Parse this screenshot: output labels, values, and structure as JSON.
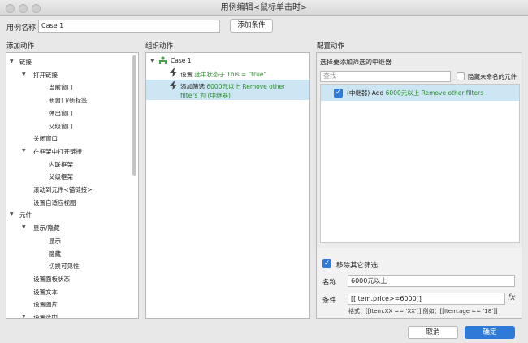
{
  "window": {
    "title": "用例编辑<鼠标单击时>"
  },
  "case_name": {
    "label": "用例名称",
    "value": "Case 1",
    "add_condition": "添加条件"
  },
  "left": {
    "title": "添加动作",
    "items": [
      {
        "label": "链接",
        "level": 0,
        "arrow": true
      },
      {
        "label": "打开链接",
        "level": 1,
        "arrow": true
      },
      {
        "label": "当前窗口",
        "level": 2,
        "arrow": false
      },
      {
        "label": "新窗口/新标签",
        "level": 2,
        "arrow": false
      },
      {
        "label": "弹出窗口",
        "level": 2,
        "arrow": false
      },
      {
        "label": "父级窗口",
        "level": 2,
        "arrow": false
      },
      {
        "label": "关闭窗口",
        "level": 1,
        "arrow": false
      },
      {
        "label": "在框架中打开链接",
        "level": 1,
        "arrow": true
      },
      {
        "label": "内联框架",
        "level": 2,
        "arrow": false
      },
      {
        "label": "父级框架",
        "level": 2,
        "arrow": false
      },
      {
        "label": "滚动到元件<锚链接>",
        "level": 1,
        "arrow": false
      },
      {
        "label": "设置自适应视图",
        "level": 1,
        "arrow": false
      },
      {
        "label": "元件",
        "level": 0,
        "arrow": true
      },
      {
        "label": "显示/隐藏",
        "level": 1,
        "arrow": true
      },
      {
        "label": "显示",
        "level": 2,
        "arrow": false
      },
      {
        "label": "隐藏",
        "level": 2,
        "arrow": false
      },
      {
        "label": "切换可见性",
        "level": 2,
        "arrow": false
      },
      {
        "label": "设置面板状态",
        "level": 1,
        "arrow": false
      },
      {
        "label": "设置文本",
        "level": 1,
        "arrow": false
      },
      {
        "label": "设置图片",
        "level": 1,
        "arrow": false
      },
      {
        "label": "设置选中",
        "level": 1,
        "arrow": true
      }
    ]
  },
  "middle": {
    "title": "组织动作",
    "case_label": "Case 1",
    "action1": {
      "prefix": "设置",
      "detail": "选中状态于 This = \"true\""
    },
    "action2": {
      "prefix": "添加筛选",
      "detail_line1": "6000元以上 Remove other",
      "detail_line2": "filters 为 (中继器)"
    }
  },
  "right": {
    "title": "配置动作",
    "subtitle": "选择要添加筛选的中继器",
    "search_placeholder": "查找",
    "hide_unnamed": "隐藏未命名的元件",
    "repeater_item": {
      "prefix": "(中继器) Add",
      "detail": "6000元以上 Remove other filters"
    },
    "remove_other": "移除其它筛选",
    "name_label": "名称",
    "name_value": "6000元以上",
    "condition_label": "条件",
    "condition_value": "[[Item.price>=6000]]",
    "fx": "fx",
    "hint": "格式：[[Item.XX == 'XX']] 例如：[[Item.age == '18']]"
  },
  "footer": {
    "cancel": "取消",
    "ok": "确定"
  },
  "colors": {
    "accent": "#2f7ad8",
    "selected_row": "#cce6f4",
    "green_text": "#2c8c2c"
  }
}
